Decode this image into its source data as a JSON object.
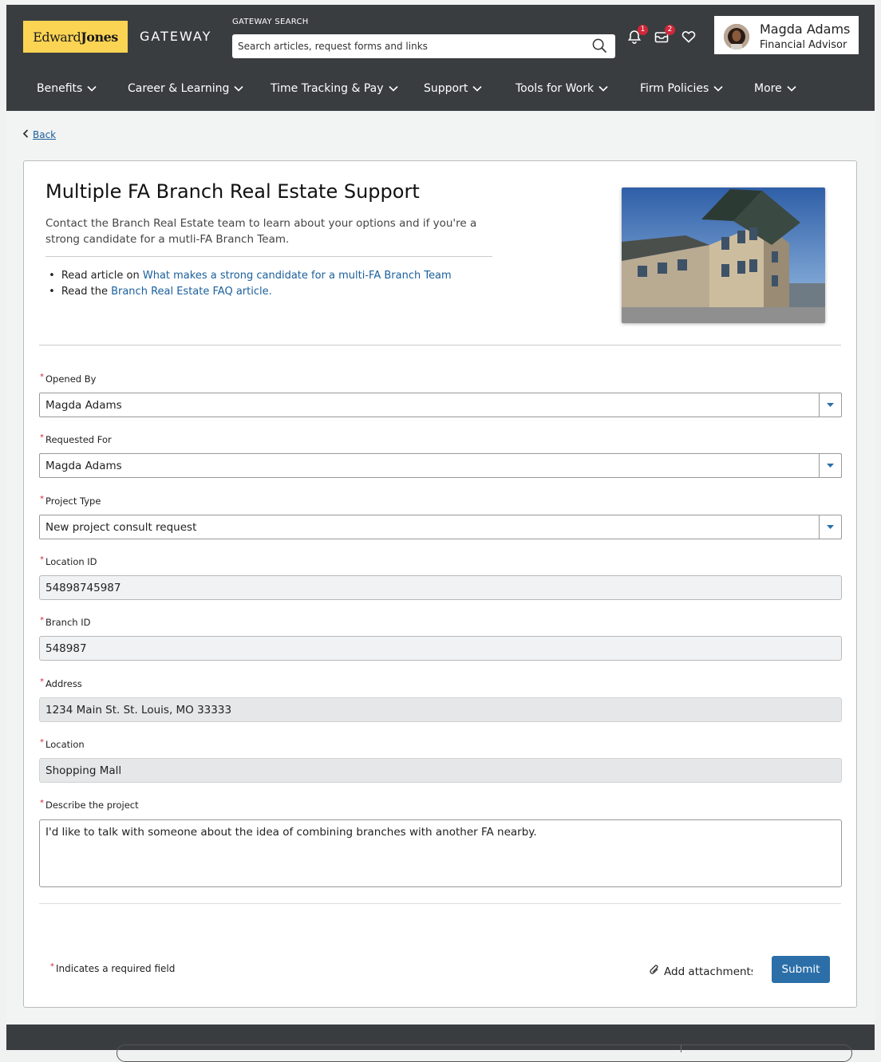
{
  "header": {
    "logo_text_1": "Edward",
    "logo_text_2": "Jones",
    "gateway_label": "GATEWAY",
    "search_label": "GATEWAY SEARCH",
    "search_placeholder": "Search articles, request forms and links",
    "notifications_count": "1",
    "inbox_count": "2",
    "user_name": "Magda Adams",
    "user_role": "Financial Advisor"
  },
  "nav": {
    "items": [
      {
        "label": "Benefits"
      },
      {
        "label": "Career & Learning"
      },
      {
        "label": "Time Tracking & Pay"
      },
      {
        "label": "Support"
      },
      {
        "label": "Tools for Work"
      },
      {
        "label": "Firm Policies"
      },
      {
        "label": "More"
      }
    ]
  },
  "back_label": "Back",
  "page": {
    "title": "Multiple FA Branch Real Estate Support",
    "intro": "Contact the Branch Real Estate team to learn about your options and if you're a strong candidate for a mutli-FA Branch Team.",
    "bullet1_prefix": "Read article on ",
    "bullet1_link": "What makes a strong candidate for a multi-FA Branch Team",
    "bullet2_prefix": "Read the ",
    "bullet2_link": "Branch Real Estate FAQ article."
  },
  "form": {
    "opened_by": {
      "label": "Opened By",
      "value": "Magda Adams"
    },
    "requested_for": {
      "label": "Requested For",
      "value": "Magda Adams"
    },
    "project_type": {
      "label": "Project Type",
      "value": "New project consult request"
    },
    "location_id": {
      "label": "Location ID",
      "value": "54898745987"
    },
    "branch_id": {
      "label": "Branch ID",
      "value": "548987"
    },
    "address": {
      "label": "Address",
      "value": "1234 Main St. St. Louis, MO 33333"
    },
    "location": {
      "label": "Location",
      "value": "Shopping Mall"
    },
    "describe": {
      "label": "Describe the project",
      "value": "I'd like to talk with someone about the idea of combining branches with another FA nearby."
    },
    "required_note": "Indicates a required field",
    "required_mark": "*",
    "attach_label": "Add attachments",
    "submit_label": "Submit"
  },
  "colors": {
    "header_bg": "#3a3d40",
    "logo_bg": "#fcd454",
    "link": "#1a5f9c",
    "submit": "#2c6fa8",
    "required": "#d0283a"
  }
}
